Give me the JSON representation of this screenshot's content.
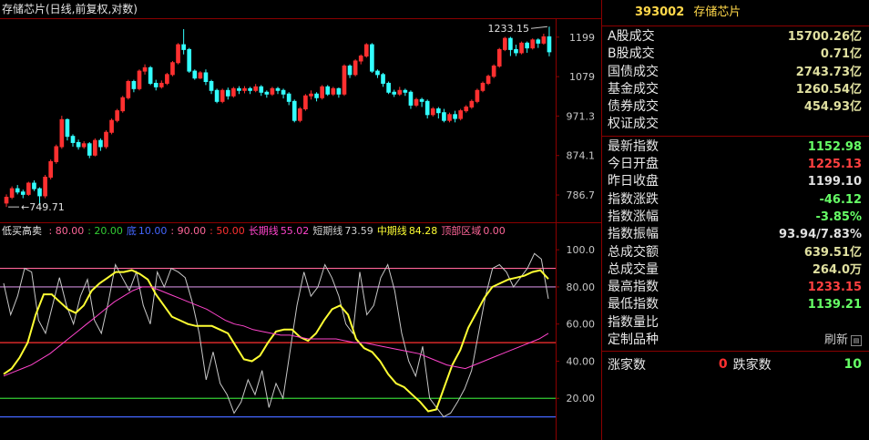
{
  "title": "存储芯片(日线,前复权,对数)",
  "indicator": {
    "name": "低买高卖",
    "items": [
      {
        "label": "",
        "value": "80.00",
        "color": "#ff6699"
      },
      {
        "label": "",
        "value": "20.00",
        "color": "#33cc33"
      },
      {
        "label": "底",
        "value": "10.00",
        "color": "#4466ff"
      },
      {
        "label": "",
        "value": "90.00",
        "color": "#ff6699"
      },
      {
        "label": "",
        "value": "50.00",
        "color": "#ff3030"
      },
      {
        "label": "长期线",
        "value": "55.02",
        "color": "#ff44cc"
      },
      {
        "label": "短期线",
        "value": "73.59",
        "color": "#d0d0d0"
      },
      {
        "label": "中期线",
        "value": "84.28",
        "color": "#ffff33"
      },
      {
        "label": "顶部区域",
        "value": "0.00",
        "color": "#ff6699"
      }
    ]
  },
  "chart_data": [
    {
      "type": "candlestick",
      "title": "存储芯片(日线,前复权,对数)",
      "y_ticks": [
        "1199",
        "1079",
        "971.3",
        "874.1",
        "786.7"
      ],
      "y_tick_values": [
        1199,
        1079,
        971.3,
        874.1,
        786.7
      ],
      "ylim": [
        735,
        1255
      ],
      "log_scale": true,
      "annotations": {
        "high": "1233.15",
        "low": "749.71"
      },
      "colors": {
        "up": "#ff3030",
        "down": "#33ffff"
      },
      "candles": [
        [
          770,
          782,
          762,
          788
        ],
        [
          782,
          800,
          778,
          805
        ],
        [
          800,
          793,
          788,
          808
        ],
        [
          793,
          788,
          780,
          798
        ],
        [
          788,
          812,
          785,
          815
        ],
        [
          812,
          800,
          795,
          818
        ],
        [
          800,
          785,
          765,
          803
        ],
        [
          785,
          825,
          780,
          830
        ],
        [
          825,
          860,
          820,
          865
        ],
        [
          860,
          895,
          855,
          900
        ],
        [
          895,
          962,
          890,
          972
        ],
        [
          962,
          920,
          910,
          965
        ],
        [
          920,
          905,
          895,
          925
        ],
        [
          905,
          895,
          888,
          912
        ],
        [
          895,
          902,
          890,
          908
        ],
        [
          902,
          875,
          868,
          906
        ],
        [
          875,
          910,
          872,
          915
        ],
        [
          910,
          895,
          885,
          915
        ],
        [
          895,
          930,
          890,
          935
        ],
        [
          930,
          960,
          925,
          965
        ],
        [
          960,
          985,
          955,
          990
        ],
        [
          985,
          1020,
          980,
          1025
        ],
        [
          1020,
          1065,
          1015,
          1070
        ],
        [
          1065,
          1045,
          1035,
          1070
        ],
        [
          1045,
          1095,
          1040,
          1100
        ],
        [
          1095,
          1105,
          1085,
          1115
        ],
        [
          1105,
          1060,
          1055,
          1110
        ],
        [
          1060,
          1050,
          1040,
          1070
        ],
        [
          1050,
          1060,
          1045,
          1068
        ],
        [
          1060,
          1085,
          1055,
          1090
        ],
        [
          1085,
          1120,
          1080,
          1125
        ],
        [
          1120,
          1175,
          1115,
          1180
        ],
        [
          1175,
          1160,
          1145,
          1225
        ],
        [
          1160,
          1095,
          1090,
          1165
        ],
        [
          1095,
          1075,
          1070,
          1100
        ],
        [
          1075,
          1090,
          1072,
          1095
        ],
        [
          1090,
          1065,
          1055,
          1100
        ],
        [
          1065,
          1040,
          1030,
          1070
        ],
        [
          1040,
          1010,
          1005,
          1045
        ],
        [
          1010,
          1040,
          1005,
          1045
        ],
        [
          1040,
          1025,
          1015,
          1048
        ],
        [
          1025,
          1045,
          1020,
          1050
        ],
        [
          1045,
          1040,
          1030,
          1052
        ],
        [
          1040,
          1045,
          1032,
          1052
        ],
        [
          1045,
          1040,
          1030,
          1050
        ],
        [
          1040,
          1050,
          1035,
          1058
        ],
        [
          1050,
          1035,
          1025,
          1055
        ],
        [
          1035,
          1030,
          1020,
          1040
        ],
        [
          1030,
          1045,
          1025,
          1050
        ],
        [
          1045,
          1040,
          1030,
          1050
        ],
        [
          1040,
          1030,
          1018,
          1045
        ],
        [
          1030,
          1010,
          1000,
          1035
        ],
        [
          1010,
          960,
          955,
          1015
        ],
        [
          960,
          990,
          955,
          995
        ],
        [
          990,
          1025,
          985,
          1030
        ],
        [
          1025,
          1030,
          1015,
          1040
        ],
        [
          1030,
          1020,
          1010,
          1035
        ],
        [
          1020,
          1050,
          1015,
          1055
        ],
        [
          1050,
          1030,
          1025,
          1055
        ],
        [
          1030,
          1045,
          1025,
          1050
        ],
        [
          1045,
          1030,
          1020,
          1048
        ],
        [
          1030,
          1110,
          1025,
          1115
        ],
        [
          1110,
          1085,
          1075,
          1115
        ],
        [
          1085,
          1125,
          1080,
          1130
        ],
        [
          1125,
          1140,
          1115,
          1145
        ],
        [
          1140,
          1175,
          1135,
          1180
        ],
        [
          1175,
          1095,
          1090,
          1180
        ],
        [
          1095,
          1085,
          1075,
          1100
        ],
        [
          1085,
          1060,
          1050,
          1090
        ],
        [
          1060,
          1035,
          1030,
          1065
        ],
        [
          1035,
          1030,
          1022,
          1042
        ],
        [
          1030,
          1040,
          1025,
          1050
        ],
        [
          1040,
          1035,
          1025,
          1045
        ],
        [
          1035,
          1000,
          990,
          1040
        ],
        [
          1000,
          1015,
          995,
          1020
        ],
        [
          1015,
          1010,
          995,
          1020
        ],
        [
          1010,
          975,
          965,
          1015
        ],
        [
          975,
          990,
          970,
          995
        ],
        [
          990,
          980,
          965,
          995
        ],
        [
          980,
          960,
          955,
          990
        ],
        [
          960,
          975,
          955,
          980
        ],
        [
          975,
          965,
          955,
          985
        ],
        [
          965,
          985,
          960,
          990
        ],
        [
          985,
          995,
          980,
          1000
        ],
        [
          995,
          1010,
          990,
          1015
        ],
        [
          1010,
          1040,
          1005,
          1045
        ],
        [
          1040,
          1060,
          1035,
          1065
        ],
        [
          1060,
          1080,
          1055,
          1085
        ],
        [
          1080,
          1110,
          1075,
          1115
        ],
        [
          1110,
          1160,
          1105,
          1165
        ],
        [
          1160,
          1195,
          1155,
          1200
        ],
        [
          1195,
          1160,
          1140,
          1200
        ],
        [
          1160,
          1150,
          1140,
          1175
        ],
        [
          1150,
          1180,
          1145,
          1185
        ],
        [
          1180,
          1165,
          1150,
          1185
        ],
        [
          1165,
          1190,
          1160,
          1195
        ],
        [
          1190,
          1180,
          1165,
          1195
        ],
        [
          1180,
          1200,
          1175,
          1210
        ],
        [
          1200,
          1152.98,
          1139.21,
          1233.15
        ]
      ]
    },
    {
      "type": "line",
      "title": "低买高卖",
      "y_ticks": [
        "100.0",
        "80.00",
        "60.00",
        "40.00",
        "20.00"
      ],
      "y_tick_values": [
        100,
        80,
        60,
        40,
        20
      ],
      "ylim": [
        0,
        105
      ],
      "hlines": [
        {
          "value": 90,
          "color": "#ff6699"
        },
        {
          "value": 80,
          "color": "#c98ad6"
        },
        {
          "value": 50,
          "color": "#ff3030"
        },
        {
          "value": 20,
          "color": "#33cc33"
        },
        {
          "value": 10,
          "color": "#4466ff"
        }
      ],
      "series": [
        {
          "name": "短期线",
          "color": "#c8c8c8",
          "values": [
            82,
            65,
            75,
            90,
            88,
            62,
            55,
            70,
            85,
            70,
            60,
            75,
            84,
            62,
            55,
            72,
            92,
            85,
            78,
            88,
            70,
            60,
            88,
            80,
            90,
            88,
            85,
            72,
            55,
            30,
            45,
            28,
            22,
            12,
            18,
            30,
            22,
            35,
            15,
            28,
            20,
            45,
            70,
            88,
            75,
            80,
            92,
            85,
            75,
            60,
            55,
            88,
            65,
            70,
            85,
            92,
            78,
            55,
            40,
            32,
            48,
            20,
            15,
            10,
            12,
            18,
            25,
            35,
            55,
            75,
            90,
            92,
            88,
            80,
            85,
            90,
            98,
            95,
            73.59
          ]
        },
        {
          "name": "中期线",
          "color": "#ffff33",
          "values": [
            33,
            36,
            42,
            50,
            65,
            76,
            76,
            72,
            68,
            66,
            70,
            78,
            82,
            85,
            88,
            88,
            89,
            87,
            84,
            76,
            70,
            64,
            62,
            60,
            59,
            59,
            59,
            57,
            55,
            48,
            41,
            40,
            43,
            50,
            56,
            57,
            57,
            53,
            51,
            55,
            62,
            68,
            70,
            65,
            52,
            47,
            45,
            40,
            33,
            28,
            26,
            22,
            18,
            13,
            14,
            26,
            38,
            46,
            58,
            66,
            74,
            80,
            82,
            84,
            85,
            86,
            88,
            89,
            84.28
          ]
        },
        {
          "name": "长期线",
          "color": "#ff44cc",
          "values": [
            32,
            34,
            36,
            38,
            41,
            44,
            48,
            52,
            56,
            60,
            64,
            68,
            72,
            75,
            78,
            80,
            80,
            78,
            76,
            74,
            72,
            70,
            68,
            65,
            62,
            60,
            59,
            57,
            56,
            55,
            54,
            54,
            53,
            52,
            52,
            52,
            52,
            51,
            50,
            50,
            49,
            48,
            47,
            46,
            45,
            44,
            42,
            40,
            38,
            37,
            36,
            38,
            40,
            42,
            44,
            46,
            48,
            50,
            52,
            55.02
          ]
        }
      ]
    }
  ],
  "side": {
    "code": "393002",
    "name": "存储芯片",
    "rows": [
      {
        "label": "A股成交",
        "value": "15700.26亿",
        "color": "#e0e0a0"
      },
      {
        "label": "B股成交",
        "value": "0.71亿",
        "color": "#e0e0a0"
      },
      {
        "label": "国债成交",
        "value": "2743.73亿",
        "color": "#e0e0a0"
      },
      {
        "label": "基金成交",
        "value": "1260.54亿",
        "color": "#e0e0a0"
      },
      {
        "label": "债券成交",
        "value": "454.93亿",
        "color": "#e0e0a0"
      },
      {
        "label": "权证成交",
        "value": "",
        "color": "#e0e0a0"
      }
    ],
    "rows2": [
      {
        "label": "最新指数",
        "value": "1152.98",
        "color": "#66ff66"
      },
      {
        "label": "今日开盘",
        "value": "1225.13",
        "color": "#ff4040"
      },
      {
        "label": "昨日收盘",
        "value": "1199.10",
        "color": "#e0e0e0"
      },
      {
        "label": "指数涨跌",
        "value": "-46.12",
        "color": "#66ff66"
      },
      {
        "label": "指数涨幅",
        "value": "-3.85%",
        "color": "#66ff66"
      },
      {
        "label": "指数振幅",
        "value": "93.94/7.83%",
        "color": "#e0e0e0"
      },
      {
        "label": "总成交额",
        "value": "639.51亿",
        "color": "#e0e0a0"
      },
      {
        "label": "总成交量",
        "value": "264.0万",
        "color": "#e0e0a0"
      },
      {
        "label": "最高指数",
        "value": "1233.15",
        "color": "#ff4040"
      },
      {
        "label": "最低指数",
        "value": "1139.21",
        "color": "#66ff66"
      },
      {
        "label": "指数量比",
        "value": "",
        "color": "#e0e0e0"
      },
      {
        "label": "定制品种",
        "value": "",
        "color": "#e0e0e0"
      }
    ],
    "refresh_label": "刷新",
    "up_label": "涨家数",
    "up_count": "0",
    "down_label": "跌家数",
    "down_count": "10"
  }
}
